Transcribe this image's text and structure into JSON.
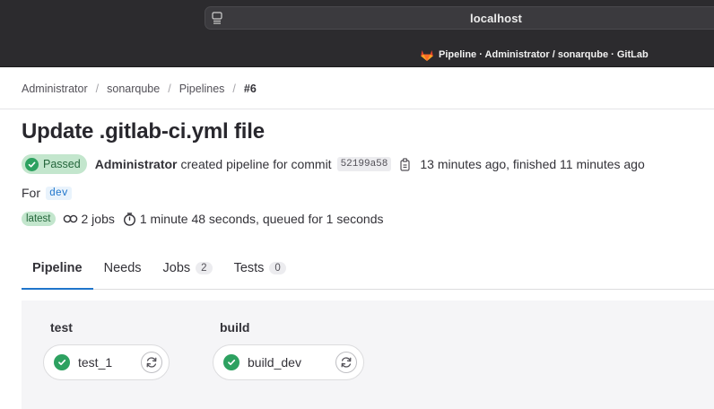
{
  "browser": {
    "url": "localhost",
    "tab_title": "Pipeline · Administrator / sonarqube · GitLab"
  },
  "breadcrumb": {
    "items": [
      "Administrator",
      "sonarqube",
      "Pipelines"
    ],
    "current": "#6"
  },
  "page": {
    "title": "Update .gitlab-ci.yml file"
  },
  "meta": {
    "status": "Passed",
    "author": "Administrator",
    "action_text": "created pipeline for commit",
    "commit_sha": "52199a58",
    "time_text": "13 minutes ago, finished 11 minutes ago",
    "for_label": "For",
    "branch": "dev"
  },
  "info": {
    "latest_badge": "latest",
    "jobs_text": "2 jobs",
    "duration_text": "1 minute 48 seconds, queued for 1 seconds"
  },
  "tabs": [
    {
      "label": "Pipeline",
      "count": null
    },
    {
      "label": "Needs",
      "count": null
    },
    {
      "label": "Jobs",
      "count": "2"
    },
    {
      "label": "Tests",
      "count": "0"
    }
  ],
  "stages": [
    {
      "name": "test",
      "jobs": [
        {
          "name": "test_1",
          "status": "passed"
        }
      ]
    },
    {
      "name": "build",
      "jobs": [
        {
          "name": "build_dev",
          "status": "passed"
        }
      ]
    }
  ],
  "colors": {
    "success": "#2da160",
    "accent": "#1f75cb",
    "chrome": "#2c2b2e"
  }
}
